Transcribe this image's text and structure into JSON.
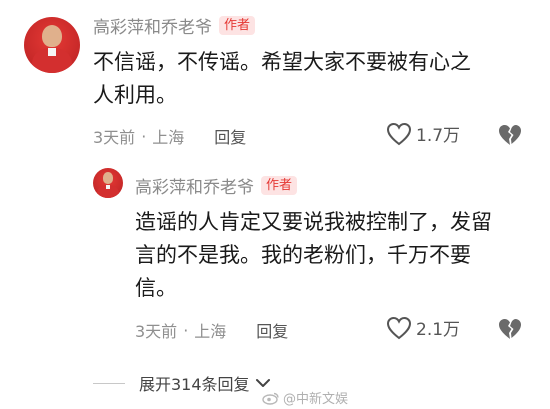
{
  "comments": [
    {
      "author": "高彩萍和乔老爷",
      "badge": "作者",
      "text_lines": [
        "不信谣，不传谣。希望大家不要被有心之",
        "人利用。"
      ],
      "time": "3天前",
      "location": "上海",
      "reply_label": "回复",
      "likes": "1.7万"
    }
  ],
  "replies": [
    {
      "author": "高彩萍和乔老爷",
      "badge": "作者",
      "text_lines": [
        "造谣的人肯定又要说我被控制了，发留",
        "言的不是我。我的老粉们，千万不要",
        "信。"
      ],
      "time": "3天前",
      "location": "上海",
      "reply_label": "回复",
      "likes": "2.1万"
    }
  ],
  "expand_label": "展开314条回复",
  "watermark": "@中新文娱",
  "icons": {
    "like": "heart-outline-icon",
    "dislike": "broken-heart-icon",
    "expand": "chevron-down-icon",
    "watermark": "weibo-logo-icon"
  },
  "colors": {
    "badge_bg": "#fde3e3",
    "badge_text": "#e53935",
    "name": "#8a8a8a",
    "meta": "#8f8f8f"
  }
}
